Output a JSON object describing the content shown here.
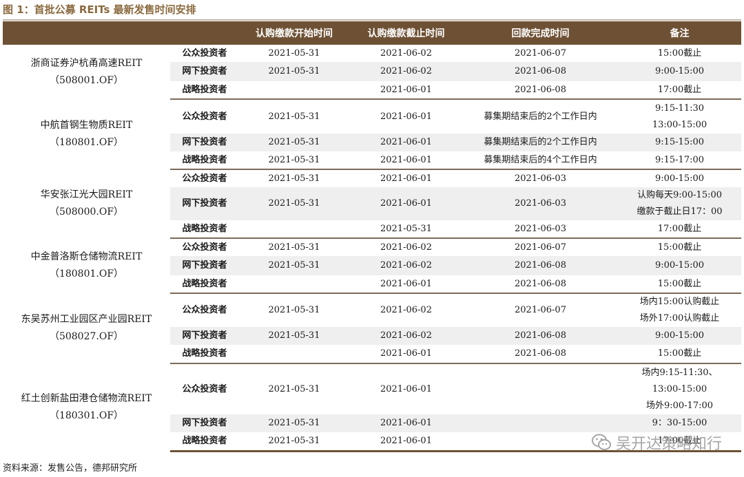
{
  "figure_title": "图 1：首批公募 REITs 最新发售时间安排",
  "source_note": "资料来源：发售公告，德邦研究所",
  "watermark": "吴开达策略知行",
  "table": {
    "headers": [
      "",
      "",
      "认购缴款开始时间",
      "认购缴款截止时间",
      "回款完成时间",
      "备注"
    ],
    "funds": [
      {
        "name": "浙商证券沪杭甬高速REIT",
        "code": "（508001.OF）",
        "rows": [
          {
            "investor": "公众投资者",
            "start": "2021-05-31",
            "end": "2021-06-02",
            "refund": "2021-06-07",
            "remark": [
              "15:00截止"
            ]
          },
          {
            "investor": "网下投资者",
            "start": "2021-05-31",
            "end": "2021-06-02",
            "refund": "2021-06-08",
            "remark": [
              "9:00-15:00"
            ]
          },
          {
            "investor": "战略投资者",
            "start": "",
            "end": "2021-06-01",
            "refund": "2021-06-08",
            "remark": [
              "17:00截止"
            ]
          }
        ]
      },
      {
        "name": "中航首钢生物质REIT",
        "code": "（180801.OF）",
        "rows": [
          {
            "investor": "公众投资者",
            "start": "2021-05-31",
            "end": "2021-06-01",
            "refund": "募集期结束后的2个工作日内",
            "remark": [
              "9:15-11:30",
              "13:00-15:00"
            ]
          },
          {
            "investor": "网下投资者",
            "start": "2021-05-31",
            "end": "2021-06-01",
            "refund": "募集期结束后的2个工作日内",
            "remark": [
              "9:15-15:00"
            ]
          },
          {
            "investor": "战略投资者",
            "start": "2021-05-31",
            "end": "2021-06-01",
            "refund": "募集期结束后的4个工作日内",
            "remark": [
              "9:15-17:00"
            ]
          }
        ]
      },
      {
        "name": "华安张江光大园REIT",
        "code": "（508000.OF）",
        "rows": [
          {
            "investor": "公众投资者",
            "start": "2021-05-31",
            "end": "2021-06-01",
            "refund": "2021-06-03",
            "remark": [
              "9:00-15:00"
            ]
          },
          {
            "investor": "网下投资者",
            "start": "2021-05-31",
            "end": "2021-06-01",
            "refund": "2021-06-03",
            "remark": [
              "认购每天9:00-15:00",
              "缴款于截止日17：00"
            ]
          },
          {
            "investor": "战略投资者",
            "start": "",
            "end": "2021-05-31",
            "refund": "2021-06-03",
            "remark": [
              "17:00截止"
            ]
          }
        ]
      },
      {
        "name": "中金普洛斯仓储物流REIT",
        "code": "（180801.OF）",
        "rows": [
          {
            "investor": "公众投资者",
            "start": "2021-05-31",
            "end": "2021-06-02",
            "refund": "2021-06-07",
            "remark": [
              "15:00截止"
            ]
          },
          {
            "investor": "网下投资者",
            "start": "2021-05-31",
            "end": "2021-06-02",
            "refund": "2021-06-08",
            "remark": [
              "9:00-15:00"
            ]
          },
          {
            "investor": "战略投资者",
            "start": "",
            "end": "2021-06-01",
            "refund": "2021-06-08",
            "remark": [
              "15:00截止"
            ]
          }
        ]
      },
      {
        "name": "东吴苏州工业园区产业园REIT",
        "code": "（508027.OF）",
        "rows": [
          {
            "investor": "公众投资者",
            "start": "2021-05-31",
            "end": "2021-06-02",
            "refund": "2021-06-07",
            "remark": [
              "场内15:00认购截止",
              "场外17:00认购截止"
            ]
          },
          {
            "investor": "网下投资者",
            "start": "2021-05-31",
            "end": "2021-06-02",
            "refund": "2021-06-08",
            "remark": [
              "9:00-15:00"
            ]
          },
          {
            "investor": "战略投资者",
            "start": "",
            "end": "2021-06-01",
            "refund": "2021-06-08",
            "remark": [
              "15:00截止"
            ]
          }
        ]
      },
      {
        "name": "红土创新盐田港仓储物流REIT",
        "code": "（180301.OF）",
        "rows": [
          {
            "investor": "公众投资者",
            "start": "2021-05-31",
            "end": "2021-06-01",
            "refund": "",
            "remark": [
              "场内9:15-11:30、",
              "13:00-15:00",
              "场外9:00-17:00"
            ]
          },
          {
            "investor": "网下投资者",
            "start": "2021-05-31",
            "end": "2021-06-01",
            "refund": "",
            "remark": [
              "9：30-15:00"
            ]
          },
          {
            "investor": "战略投资者",
            "start": "2021-05-31",
            "end": "2021-06-01",
            "refund": "",
            "remark": [
              "17:00截止"
            ]
          }
        ]
      }
    ]
  }
}
